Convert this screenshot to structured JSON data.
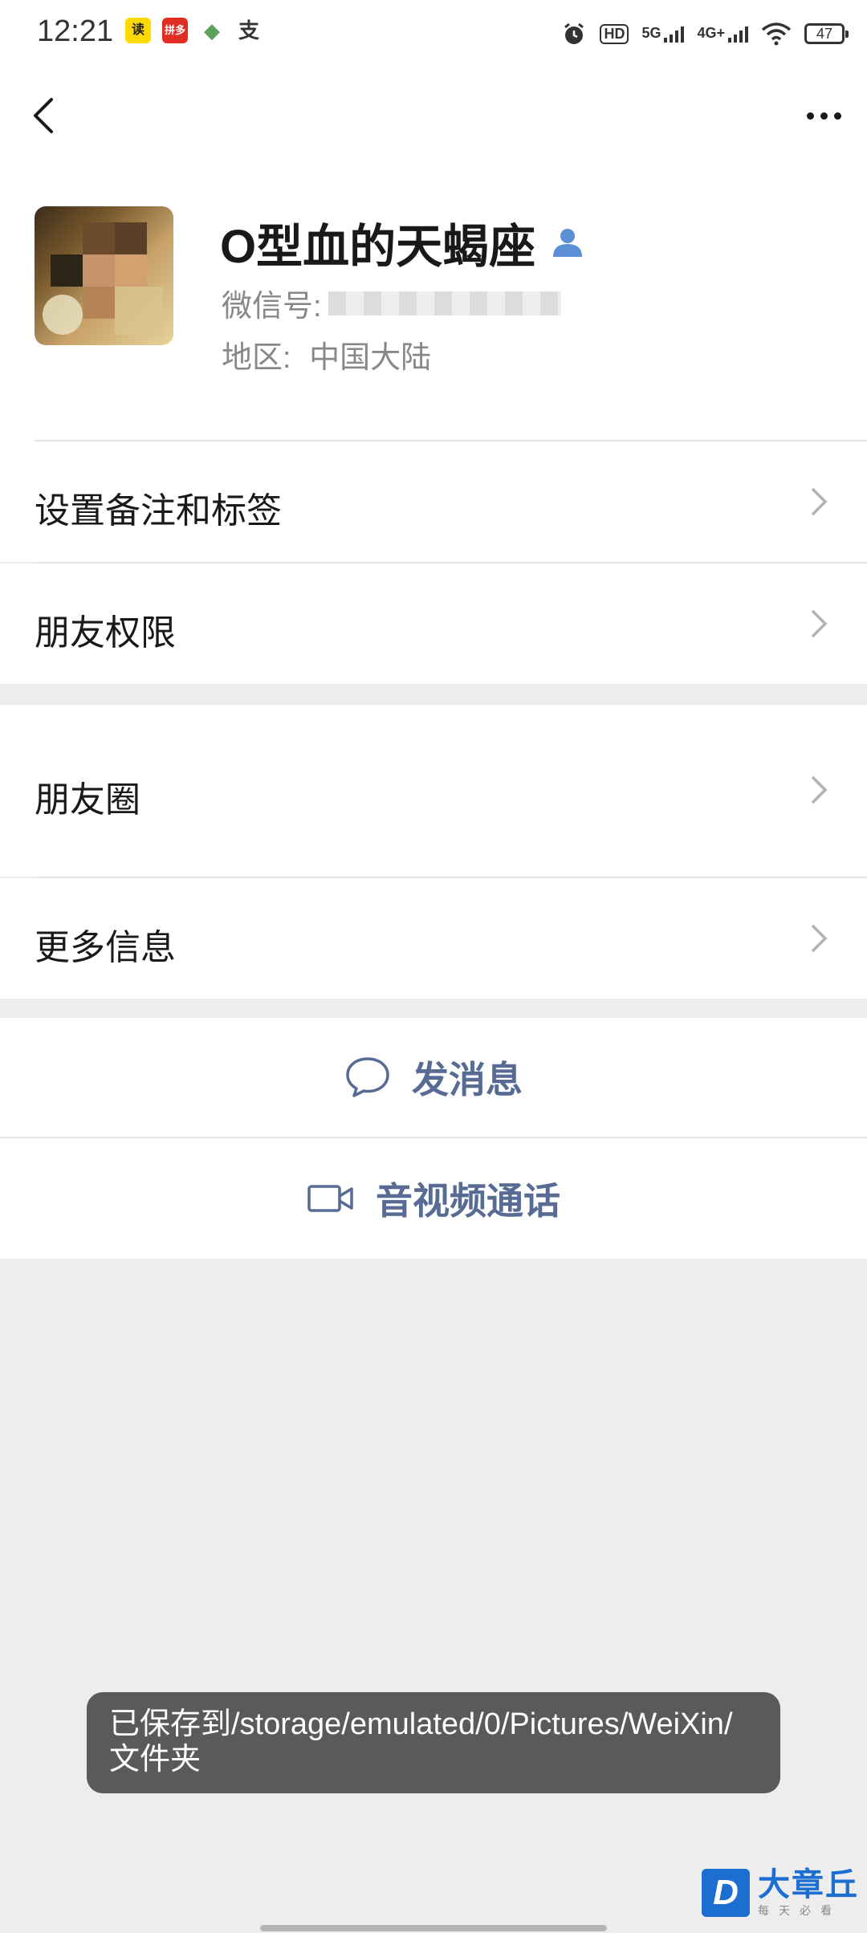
{
  "status_bar": {
    "time": "12:21",
    "app_icons": [
      {
        "name": "read-app-icon",
        "glyph": "读"
      },
      {
        "name": "pinduoduo-app-icon",
        "glyph": "拼多"
      },
      {
        "name": "book-app-icon",
        "glyph": "◆"
      },
      {
        "name": "alipay-app-icon",
        "glyph": "支"
      }
    ],
    "hd": "HD",
    "net_5g": "5G",
    "net_4g": "4G+",
    "battery": "47"
  },
  "profile": {
    "name": "O型血的天蝎座",
    "wxid_label": "微信号:",
    "region_label": "地区:",
    "region_value": "中国大陆"
  },
  "menu": {
    "group1": [
      {
        "label": "设置备注和标签"
      },
      {
        "label": "朋友权限"
      }
    ],
    "group2": [
      {
        "label": "朋友圈"
      },
      {
        "label": "更多信息"
      }
    ]
  },
  "actions": {
    "message": "发消息",
    "video_call": "音视频通话"
  },
  "toast": {
    "text": "已保存到/storage/emulated/0/Pictures/WeiXin/文件夹"
  },
  "watermark": {
    "logo": "D",
    "title": "大章丘",
    "subtitle": "每天必看"
  },
  "colors": {
    "link_blue": "#576b95",
    "background": "#ededed",
    "toast_bg": "#5a5a5a"
  }
}
